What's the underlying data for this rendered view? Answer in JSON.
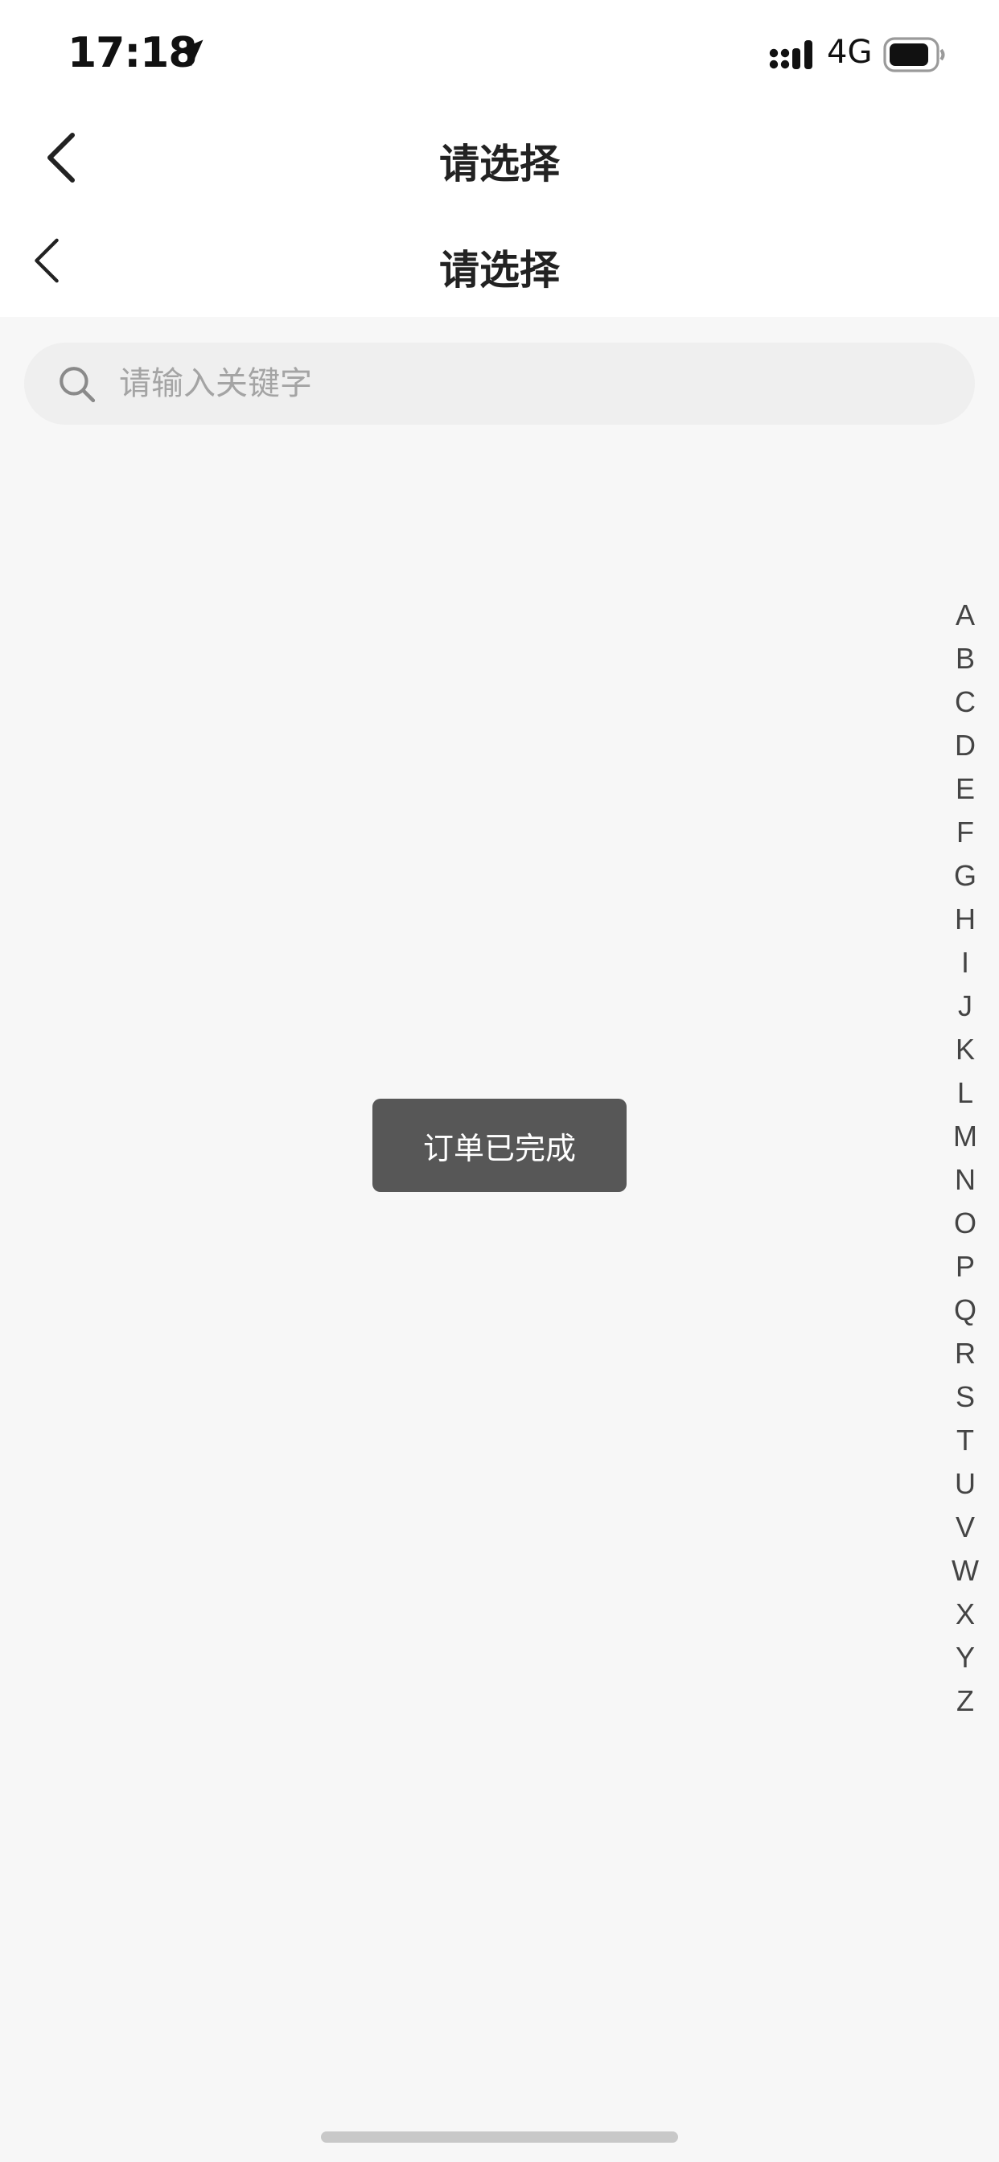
{
  "status_bar": {
    "time": "17:18",
    "network": "4G",
    "icons": [
      "location-arrow-icon",
      "signal-icon",
      "battery-icon"
    ]
  },
  "nav_outer": {
    "title": "请选择",
    "back_icon": "chevron-left-icon"
  },
  "nav_inner": {
    "title": "请选择",
    "back_icon": "chevron-left-icon"
  },
  "search": {
    "placeholder": "请输入关键字",
    "value": "",
    "icon": "search-icon"
  },
  "index_letters": [
    "A",
    "B",
    "C",
    "D",
    "E",
    "F",
    "G",
    "H",
    "I",
    "J",
    "K",
    "L",
    "M",
    "N",
    "O",
    "P",
    "Q",
    "R",
    "S",
    "T",
    "U",
    "V",
    "W",
    "X",
    "Y",
    "Z"
  ],
  "toast": {
    "message": "订单已完成",
    "background": "#575757"
  },
  "colors": {
    "page_background": "#f7f7f7",
    "bar_background": "#ffffff",
    "search_background": "#efefef"
  }
}
